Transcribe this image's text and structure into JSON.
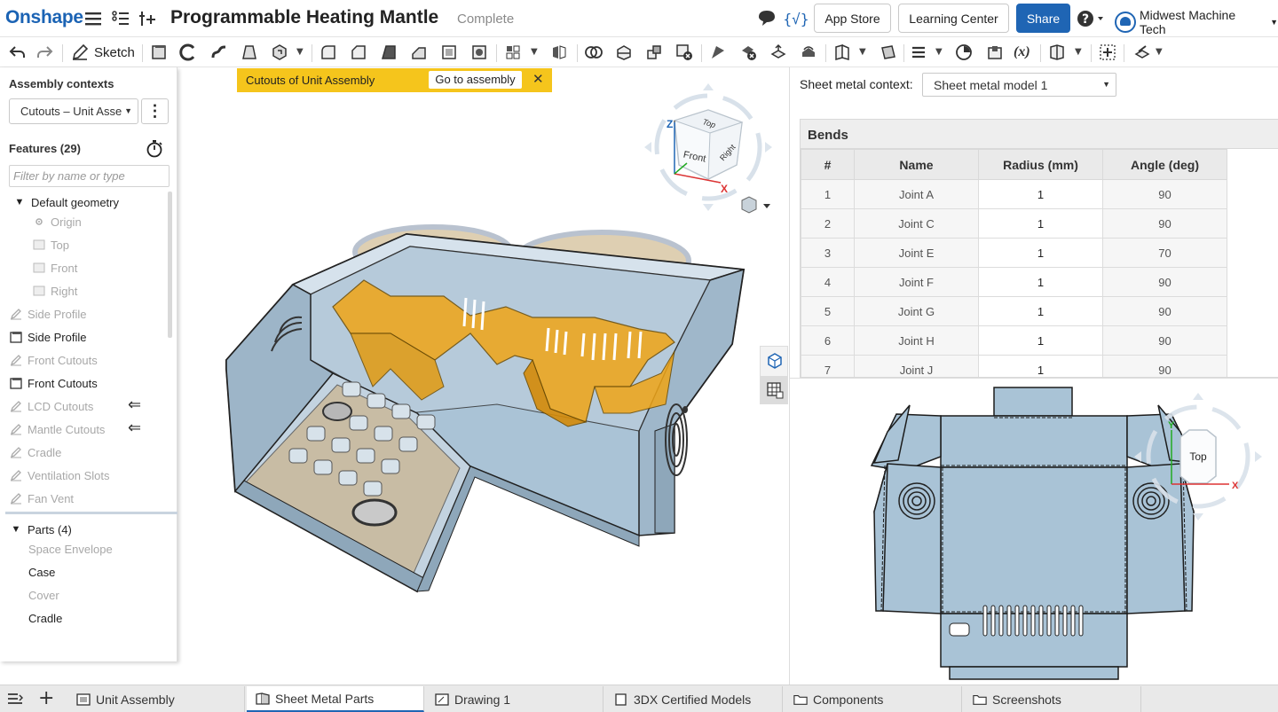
{
  "app": {
    "logo": "Onshape",
    "doc_title": "Programmable Heating Mantle",
    "doc_status": "Complete"
  },
  "header": {
    "app_store": "App Store",
    "learning_center": "Learning Center",
    "share": "Share",
    "user": "Midwest Machine Tech"
  },
  "toolbar": {
    "sketch": "Sketch",
    "variables": "(x)"
  },
  "left": {
    "contexts_label": "Assembly contexts",
    "context_value": "Cutouts – Unit Asse",
    "features_label": "Features (29)",
    "filter_placeholder": "Filter by name or type",
    "features": [
      {
        "label": "Default geometry"
      },
      {
        "label": "Origin"
      },
      {
        "label": "Top"
      },
      {
        "label": "Front"
      },
      {
        "label": "Right"
      },
      {
        "label": "Side Profile"
      },
      {
        "label": "Side Profile"
      },
      {
        "label": "Front Cutouts"
      },
      {
        "label": "Front Cutouts"
      },
      {
        "label": "LCD Cutouts"
      },
      {
        "label": "Mantle Cutouts"
      },
      {
        "label": "Cradle"
      },
      {
        "label": "Ventilation Slots"
      },
      {
        "label": "Fan Vent"
      }
    ],
    "parts_label": "Parts (4)",
    "parts": [
      {
        "label": "Space Envelope"
      },
      {
        "label": "Case"
      },
      {
        "label": "Cover"
      },
      {
        "label": "Cradle"
      }
    ]
  },
  "banner": {
    "text": "Cutouts of Unit Assembly",
    "button": "Go to assembly"
  },
  "viewcube": {
    "top": "Top",
    "front": "Front",
    "right": "Right",
    "z": "Z",
    "x": "X"
  },
  "sheet_metal": {
    "context_label": "Sheet metal context:",
    "model": "Sheet metal model 1",
    "table_title": "Bends",
    "columns": [
      "#",
      "Name",
      "Radius (mm)",
      "Angle (deg)"
    ],
    "rows": [
      [
        "1",
        "Joint A",
        "1",
        "90"
      ],
      [
        "2",
        "Joint C",
        "1",
        "90"
      ],
      [
        "3",
        "Joint E",
        "1",
        "70"
      ],
      [
        "4",
        "Joint F",
        "1",
        "90"
      ],
      [
        "5",
        "Joint G",
        "1",
        "90"
      ],
      [
        "6",
        "Joint H",
        "1",
        "90"
      ],
      [
        "7",
        "Joint J",
        "1",
        "90"
      ]
    ]
  },
  "flat_view": {
    "cube_label": "Top",
    "axis_y": "Y",
    "axis_x": "X"
  },
  "tabs": [
    {
      "label": "Unit Assembly"
    },
    {
      "label": "Sheet Metal Parts"
    },
    {
      "label": "Drawing 1"
    },
    {
      "label": "3DX Certified Models"
    },
    {
      "label": "Components"
    },
    {
      "label": "Screenshots"
    }
  ],
  "colors": {
    "brand": "#1b63b4",
    "banner": "#f5c51c",
    "part_blue": "#a9c3d6",
    "highlight_orange": "#f0a516"
  }
}
